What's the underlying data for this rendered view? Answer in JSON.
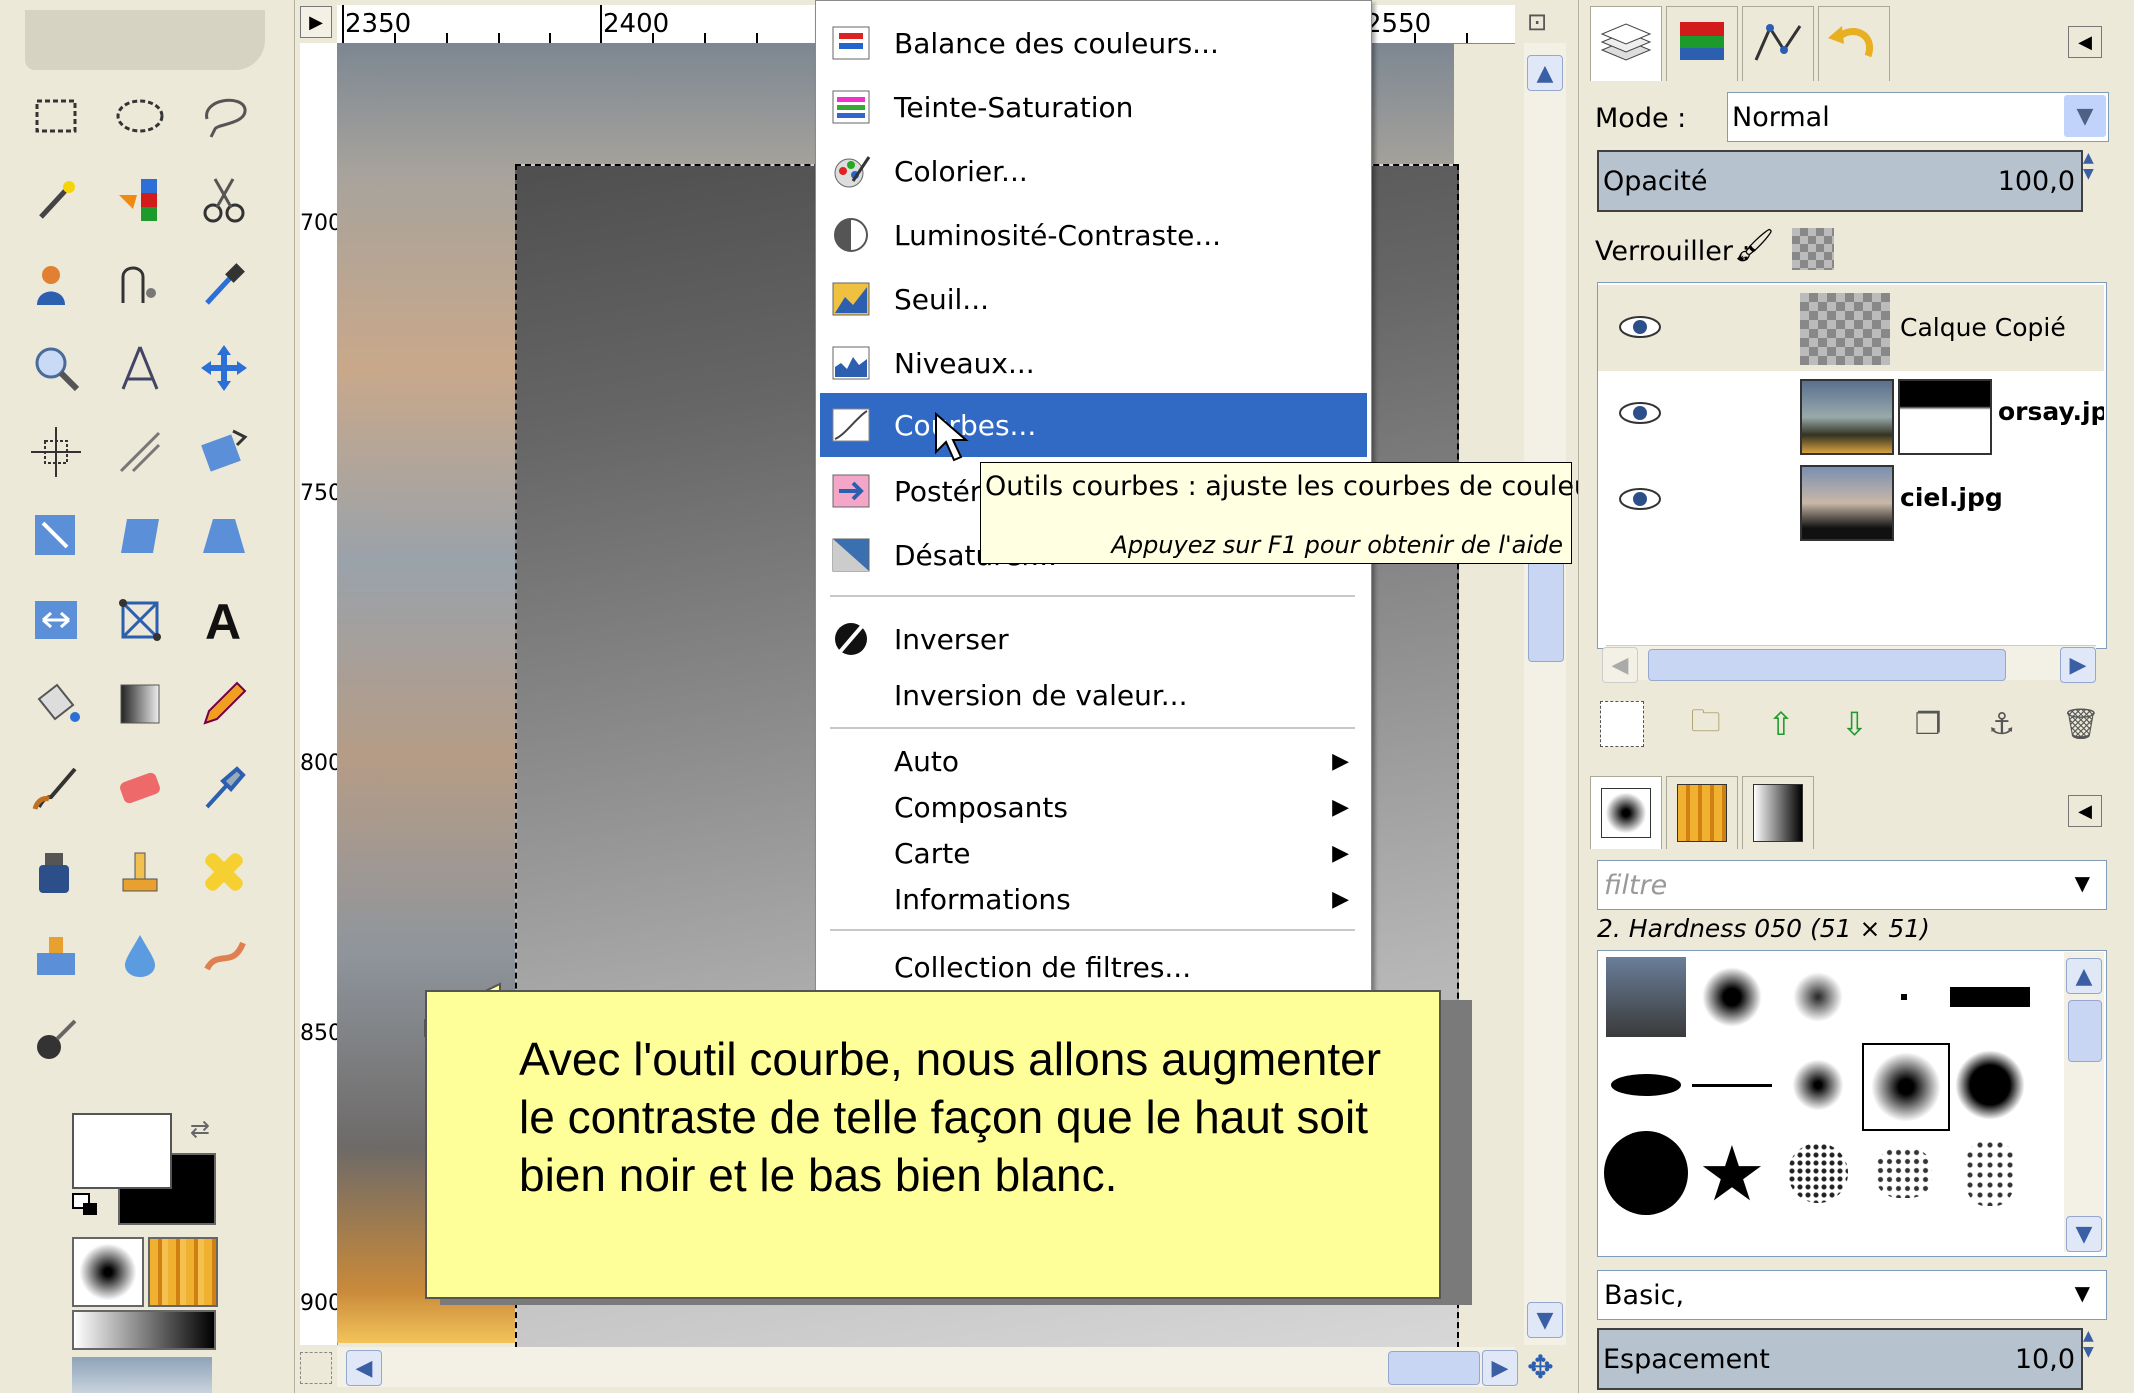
{
  "image_window": {
    "ruler_h_labels": [
      "2350",
      "2400",
      "2550"
    ],
    "ruler_v_labels": [
      "700",
      "750",
      "800",
      "850",
      "900"
    ]
  },
  "menu": {
    "items": [
      {
        "label": "Balance des couleurs...",
        "icon": "color-balance-icon"
      },
      {
        "label": "Teinte-Saturation",
        "icon": "hue-saturation-icon"
      },
      {
        "label": "Colorier...",
        "icon": "colorize-icon"
      },
      {
        "label": "Luminosité-Contraste...",
        "icon": "brightness-contrast-icon"
      },
      {
        "label": "Seuil...",
        "icon": "threshold-icon"
      },
      {
        "label": "Niveaux...",
        "icon": "levels-icon"
      },
      {
        "label": "Courbes...",
        "icon": "curves-icon",
        "highlighted": true
      },
      {
        "label": "Postériser...",
        "icon": "posterize-icon"
      },
      {
        "label": "Désaturer...",
        "icon": "desaturate-icon"
      },
      {
        "label": "Inverser",
        "icon": "invert-icon"
      },
      {
        "label": "Inversion de valeur...",
        "icon": ""
      },
      {
        "label": "Auto",
        "submenu": true
      },
      {
        "label": "Composants",
        "submenu": true
      },
      {
        "label": "Carte",
        "submenu": true
      },
      {
        "label": "Informations",
        "submenu": true
      },
      {
        "label": "Collection de filtres...",
        "icon": ""
      }
    ],
    "highlight_color": "#316ac5"
  },
  "tooltip": {
    "text": "Outils courbes : ajuste les courbes de couleur",
    "hint": "Appuyez sur F1 pour obtenir de l'aide"
  },
  "callout": {
    "text": "Avec l'outil courbe, nous allons augmenter le contraste de telle façon que le haut soit bien noir et le bas bien blanc."
  },
  "layers_panel": {
    "mode_label": "Mode :",
    "mode_value": "Normal",
    "opacity_label": "Opacité",
    "opacity_value": "100,0",
    "lock_label": "Verrouiller :",
    "layers": [
      {
        "name": "Calque Copié",
        "visible": true,
        "selected": true
      },
      {
        "name": "orsay.jp",
        "visible": true,
        "selected": false
      },
      {
        "name": "ciel.jpg",
        "visible": true,
        "selected": false
      }
    ]
  },
  "brushes_panel": {
    "filter_placeholder": "filtre",
    "brush_name": "2. Hardness 050 (51 × 51)",
    "preset_value": "Basic,",
    "spacing_label": "Espacement",
    "spacing_value": "10,0"
  }
}
